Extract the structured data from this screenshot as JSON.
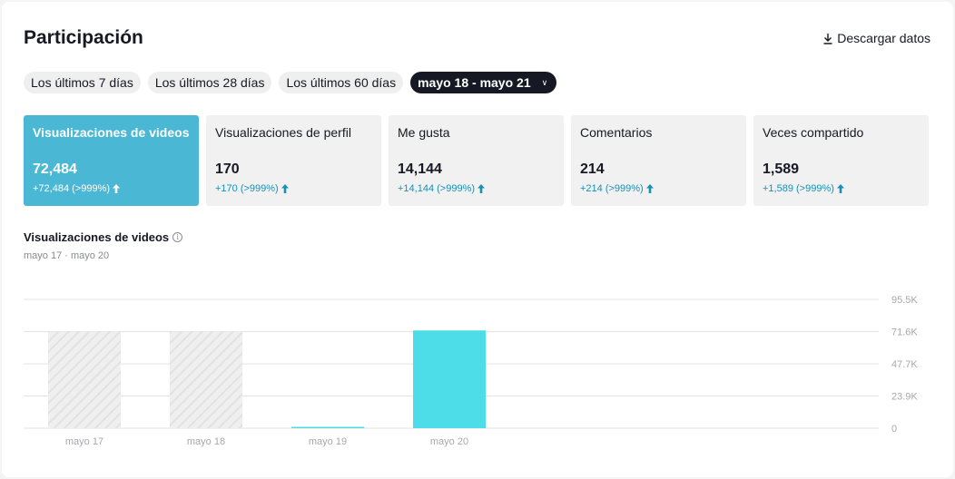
{
  "header": {
    "title": "Participación",
    "download_label": "Descargar datos"
  },
  "date_filters": {
    "options": [
      "Los últimos 7 días",
      "Los últimos 28 días",
      "Los últimos 60 días"
    ],
    "selected_range": "mayo 18 - mayo 21"
  },
  "metrics": [
    {
      "label": "Visualizaciones de videos",
      "value": "72,484",
      "delta": "+72,484 (>999%)",
      "active": true
    },
    {
      "label": "Visualizaciones de perfil",
      "value": "170",
      "delta": "+170 (>999%)",
      "active": false
    },
    {
      "label": "Me gusta",
      "value": "14,144",
      "delta": "+14,144 (>999%)",
      "active": false
    },
    {
      "label": "Comentarios",
      "value": "214",
      "delta": "+214 (>999%)",
      "active": false
    },
    {
      "label": "Veces compartido",
      "value": "1,589",
      "delta": "+1,589 (>999%)",
      "active": false
    }
  ],
  "chart_section": {
    "title": "Visualizaciones de videos",
    "subtitle": "mayo 17 · mayo 20"
  },
  "colors": {
    "accent": "#4ab8d4",
    "bar": "#4ddde9",
    "delta": "#1a8fb4",
    "dark": "#161823"
  },
  "chart_data": {
    "type": "bar",
    "categories": [
      "mayo 17",
      "mayo 18",
      "mayo 19",
      "mayo 20"
    ],
    "values": [
      71600,
      71600,
      300,
      72484
    ],
    "placeholder": [
      true,
      true,
      false,
      false
    ],
    "ylim": [
      0,
      95500
    ],
    "yticks": [
      0,
      23900,
      47700,
      71600,
      95500
    ],
    "ytick_labels": [
      "0",
      "23.9K",
      "47.7K",
      "71.6K",
      "95.5K"
    ],
    "grid": true,
    "title": "Visualizaciones de videos"
  }
}
